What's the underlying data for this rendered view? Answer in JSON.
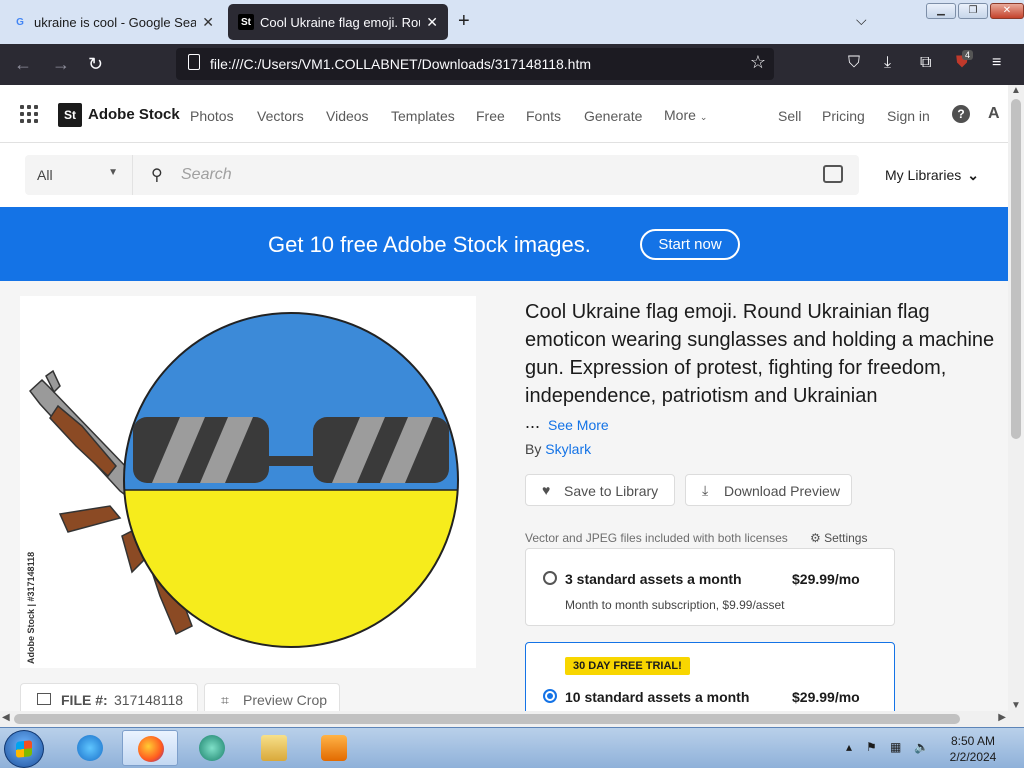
{
  "browser": {
    "tabs": [
      {
        "label": "ukraine is cool - Google Search",
        "favicon": "G"
      },
      {
        "label": "Cool Ukraine flag emoji. Round",
        "favicon": "St"
      }
    ],
    "url": "file:///C:/Users/VM1.COLLABNET/Downloads/317148118.htm",
    "extension_badge": "4"
  },
  "header": {
    "logo_mark": "St",
    "logo_text": "Adobe Stock",
    "nav": [
      "Photos",
      "Vectors",
      "Videos",
      "Templates",
      "Free",
      "Fonts",
      "Generate",
      "More"
    ],
    "right_links": [
      "Sell",
      "Pricing",
      "Sign in"
    ]
  },
  "search": {
    "filter": "All",
    "placeholder": "Search",
    "my_libraries": "My Libraries"
  },
  "promo": {
    "text": "Get 10 free Adobe Stock images.",
    "button": "Start now",
    "color": "#1473e6"
  },
  "asset": {
    "title": "Cool Ukraine flag emoji. Round Ukrainian flag emoticon wearing sunglasses and holding a machine gun. Expression of protest, fighting for freedom, independence, patriotism and Ukrainian",
    "ellipsis": "...",
    "see_more": "See More",
    "by_prefix": "By",
    "author": "Skylark",
    "credit_vertical": "Adobe Stock | #317148118",
    "file_label": "FILE #:",
    "file_number": "317148118",
    "preview_crop": "Preview Crop",
    "flag_colors": {
      "blue": "#3c8ad8",
      "yellow": "#f6ec1c"
    }
  },
  "actions": {
    "save": "Save to Library",
    "download": "Download Preview"
  },
  "licensing": {
    "note": "Vector and JPEG files included with both licenses",
    "settings": "Settings",
    "plans": [
      {
        "name": "3 standard assets a month",
        "price": "$29.99/mo",
        "sub": "Month to month subscription, $9.99/asset",
        "selected": false
      },
      {
        "badge": "30 DAY FREE TRIAL!",
        "name": "10 standard assets a month",
        "price": "$29.99/mo",
        "selected": true
      }
    ]
  },
  "taskbar": {
    "time": "8:50 AM",
    "date": "2/2/2024"
  }
}
